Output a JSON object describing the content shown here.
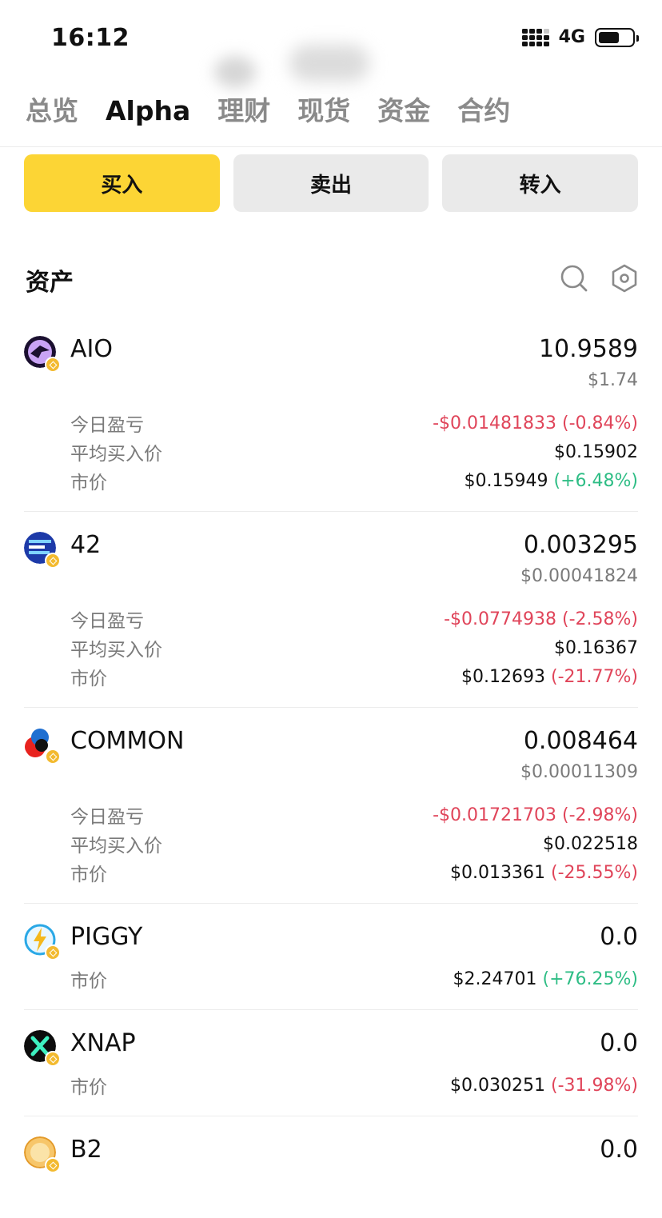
{
  "status_bar": {
    "time": "16:12",
    "network": "4G"
  },
  "tabs": [
    {
      "label": "总览",
      "active": false
    },
    {
      "label": "Alpha",
      "active": true
    },
    {
      "label": "理财",
      "active": false
    },
    {
      "label": "现货",
      "active": false
    },
    {
      "label": "资金",
      "active": false
    },
    {
      "label": "合约",
      "active": false
    }
  ],
  "actions": {
    "buy": "买入",
    "sell": "卖出",
    "transfer": "转入"
  },
  "section": {
    "title": "资产"
  },
  "labels": {
    "today_pnl": "今日盈亏",
    "avg_price": "平均买入价",
    "market_price": "市价"
  },
  "assets": [
    {
      "name": "AIO",
      "amount": "10.9589",
      "value": "$1.74",
      "today_pnl": "-$0.01481833 (-0.84%)",
      "avg_price": "$0.15902",
      "price": "$0.15949",
      "change": "(+6.48%)"
    },
    {
      "name": "42",
      "amount": "0.003295",
      "value": "$0.00041824",
      "today_pnl": "-$0.0774938 (-2.58%)",
      "avg_price": "$0.16367",
      "price": "$0.12693",
      "change": "(-21.77%)"
    },
    {
      "name": "COMMON",
      "amount": "0.008464",
      "value": "$0.00011309",
      "today_pnl": "-$0.01721703 (-2.98%)",
      "avg_price": "$0.022518",
      "price": "$0.013361",
      "change": "(-25.55%)"
    },
    {
      "name": "PIGGY",
      "amount": "0.0",
      "price": "$2.24701",
      "change": "(+76.25%)"
    },
    {
      "name": "XNAP",
      "amount": "0.0",
      "price": "$0.030251",
      "change": "(-31.98%)"
    },
    {
      "name": "B2",
      "amount": "0.0"
    }
  ],
  "colors": {
    "accent": "#fcd535",
    "negative": "#e0455a",
    "positive": "#2ebd85",
    "bnb_badge": "#f3ba2f"
  }
}
